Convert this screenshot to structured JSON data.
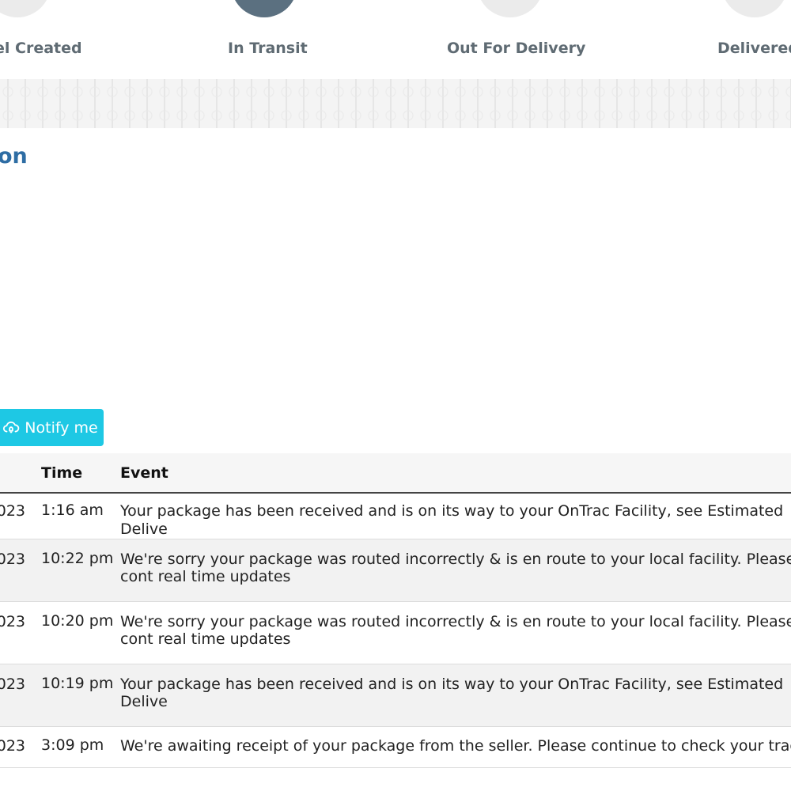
{
  "progress": {
    "steps": [
      {
        "label": "el Created",
        "active": false
      },
      {
        "label": "In Transit",
        "active": true
      },
      {
        "label": "Out For Delivery",
        "active": false
      },
      {
        "label": "Delivered",
        "active": false
      }
    ]
  },
  "section": {
    "heading": "on"
  },
  "notify_button": {
    "label": "Notify me",
    "icon": "cloud-bell-icon"
  },
  "table": {
    "headers": {
      "date": "",
      "time": "Time",
      "event": "Event"
    },
    "rows": [
      {
        "date": "023",
        "time": "1:16 am",
        "event": "Your package has been received and is on its way to your OnTrac Facility, see Estimated Delive"
      },
      {
        "date": "023",
        "time": "10:22 pm",
        "event": "We're sorry your package was routed incorrectly & is en route to your local facility. Please cont real time updates"
      },
      {
        "date": "023",
        "time": "10:20 pm",
        "event": "We're sorry your package was routed incorrectly & is en route to your local facility. Please cont real time updates"
      },
      {
        "date": "023",
        "time": "10:19 pm",
        "event": "Your package has been received and is on its way to your OnTrac Facility, see Estimated Delive"
      },
      {
        "date": "023",
        "time": "3:09 pm",
        "event": "We're awaiting receipt of your package from the seller. Please continue to check your tracking"
      }
    ]
  }
}
